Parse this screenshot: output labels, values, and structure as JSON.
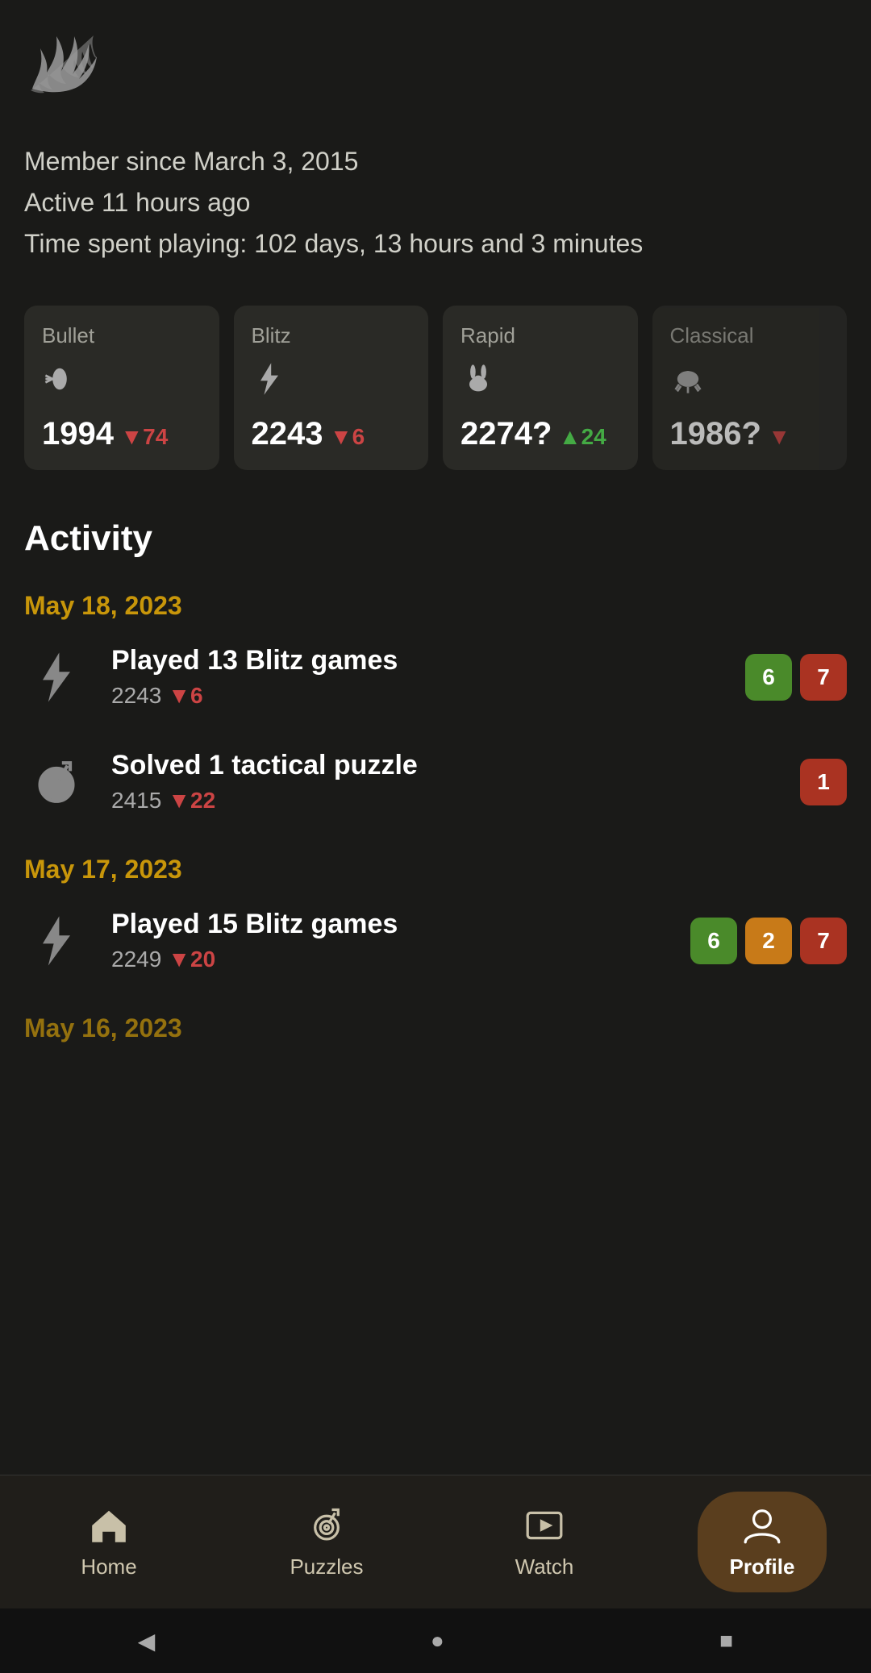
{
  "logo": {
    "alt": "Lichess logo"
  },
  "profile": {
    "member_since": "Member since March 3, 2015",
    "active": "Active 11 hours ago",
    "time_spent": "Time spent playing: 102 days, 13 hours and 3 minutes"
  },
  "ratings": [
    {
      "mode": "Bullet",
      "icon": "bullet",
      "value": "1994",
      "change_value": "74",
      "change_dir": "down"
    },
    {
      "mode": "Blitz",
      "icon": "flame",
      "value": "2243",
      "change_value": "6",
      "change_dir": "down"
    },
    {
      "mode": "Rapid",
      "icon": "rabbit",
      "value": "2274?",
      "change_value": "24",
      "change_dir": "up"
    },
    {
      "mode": "Classical",
      "icon": "turtle",
      "value": "1986?",
      "change_value": "...",
      "change_dir": "down"
    }
  ],
  "activity": {
    "title": "Activity",
    "dates": [
      {
        "date": "May 18, 2023",
        "items": [
          {
            "type": "blitz",
            "name": "Played 13 Blitz games",
            "rating": "2243",
            "change_value": "6",
            "change_dir": "down",
            "badges": [
              {
                "value": "6",
                "color": "green"
              },
              {
                "value": "7",
                "color": "red"
              }
            ]
          },
          {
            "type": "puzzle",
            "name": "Solved 1 tactical puzzle",
            "rating": "2415",
            "change_value": "22",
            "change_dir": "down",
            "badges": [
              {
                "value": "1",
                "color": "red"
              }
            ]
          }
        ]
      },
      {
        "date": "May 17, 2023",
        "items": [
          {
            "type": "blitz",
            "name": "Played 15 Blitz games",
            "rating": "2249",
            "change_value": "20",
            "change_dir": "down",
            "badges": [
              {
                "value": "6",
                "color": "green"
              },
              {
                "value": "2",
                "color": "yellow"
              },
              {
                "value": "7",
                "color": "red"
              }
            ]
          }
        ]
      },
      {
        "date": "May 16, 2023",
        "items": []
      }
    ]
  },
  "bottom_nav": {
    "items": [
      {
        "id": "home",
        "label": "Home",
        "active": false
      },
      {
        "id": "puzzles",
        "label": "Puzzles",
        "active": false
      },
      {
        "id": "watch",
        "label": "Watch",
        "active": false
      },
      {
        "id": "profile",
        "label": "Profile",
        "active": true
      }
    ]
  },
  "system_bar": {
    "back": "◀",
    "home": "●",
    "recent": "■"
  }
}
